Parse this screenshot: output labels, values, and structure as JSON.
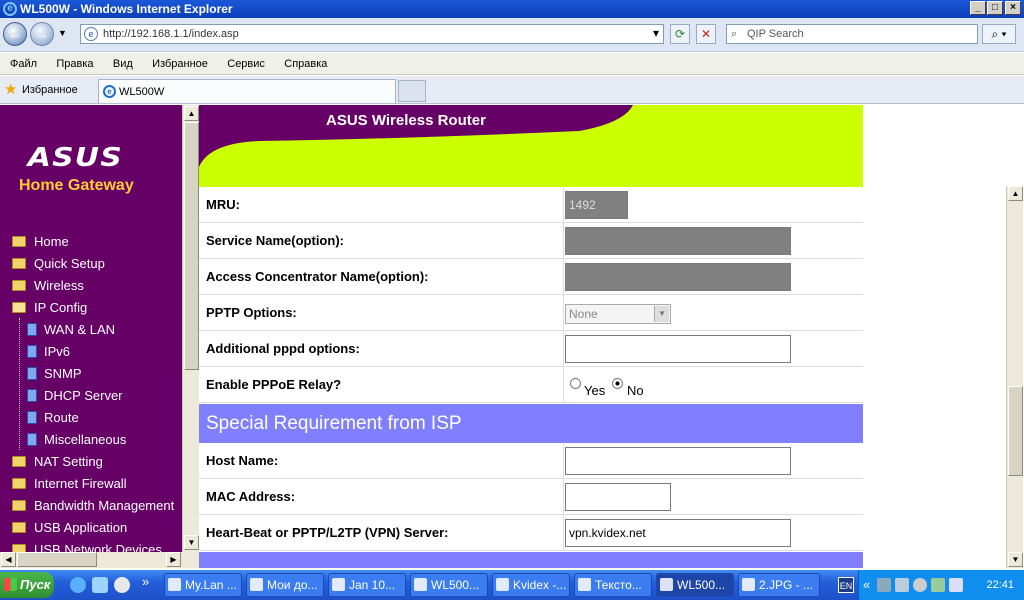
{
  "window": {
    "title": "WL500W - Windows Internet Explorer"
  },
  "nav": {
    "address": "http://192.168.1.1/index.asp",
    "search_placeholder": "QIP Search"
  },
  "menu": [
    "Файл",
    "Правка",
    "Вид",
    "Избранное",
    "Сервис",
    "Справка"
  ],
  "favorites": {
    "label": "Избранное",
    "tab_title": "WL500W"
  },
  "brand": {
    "logo": "ASUS",
    "subtitle": "Home Gateway",
    "header_title": "ASUS Wireless Router"
  },
  "sidebar": {
    "items": [
      {
        "label": "Home"
      },
      {
        "label": "Quick Setup"
      },
      {
        "label": "Wireless"
      },
      {
        "label": "IP Config"
      },
      {
        "label": "WAN & LAN"
      },
      {
        "label": "IPv6"
      },
      {
        "label": "SNMP"
      },
      {
        "label": "DHCP Server"
      },
      {
        "label": "Route"
      },
      {
        "label": "Miscellaneous"
      },
      {
        "label": "NAT Setting"
      },
      {
        "label": "Internet Firewall"
      },
      {
        "label": "Bandwidth Management"
      },
      {
        "label": "USB Application"
      },
      {
        "label": "USB Network Devices"
      }
    ]
  },
  "form": {
    "mru": {
      "label": "MRU:",
      "value": "1492"
    },
    "service_name": {
      "label": "Service Name(option):",
      "value": ""
    },
    "access_concentrator": {
      "label": "Access Concentrator Name(option):",
      "value": ""
    },
    "pptp_options": {
      "label": "PPTP Options:",
      "value": "None"
    },
    "additional_pppd": {
      "label": "Additional pppd options:",
      "value": ""
    },
    "pppoe_relay": {
      "label": "Enable PPPoE Relay?",
      "yes": "Yes",
      "no": "No",
      "selected": "No"
    },
    "section_isp": "Special Requirement from ISP",
    "host_name": {
      "label": "Host Name:",
      "value": ""
    },
    "mac_address": {
      "label": "MAC Address:",
      "value": ""
    },
    "heartbeat": {
      "label": "Heart-Beat or PPTP/L2TP (VPN) Server:",
      "value": "vpn.kvidex.net"
    }
  },
  "taskbar": {
    "start": "Пуск",
    "tasks": [
      "My.Lan ...",
      "Мои до...",
      "Jan 10...",
      "WL500...",
      "Kvidex -...",
      "Тексто...",
      "WL500...",
      "2.JPG - ..."
    ],
    "lang": "EN",
    "clock": "22:41"
  }
}
